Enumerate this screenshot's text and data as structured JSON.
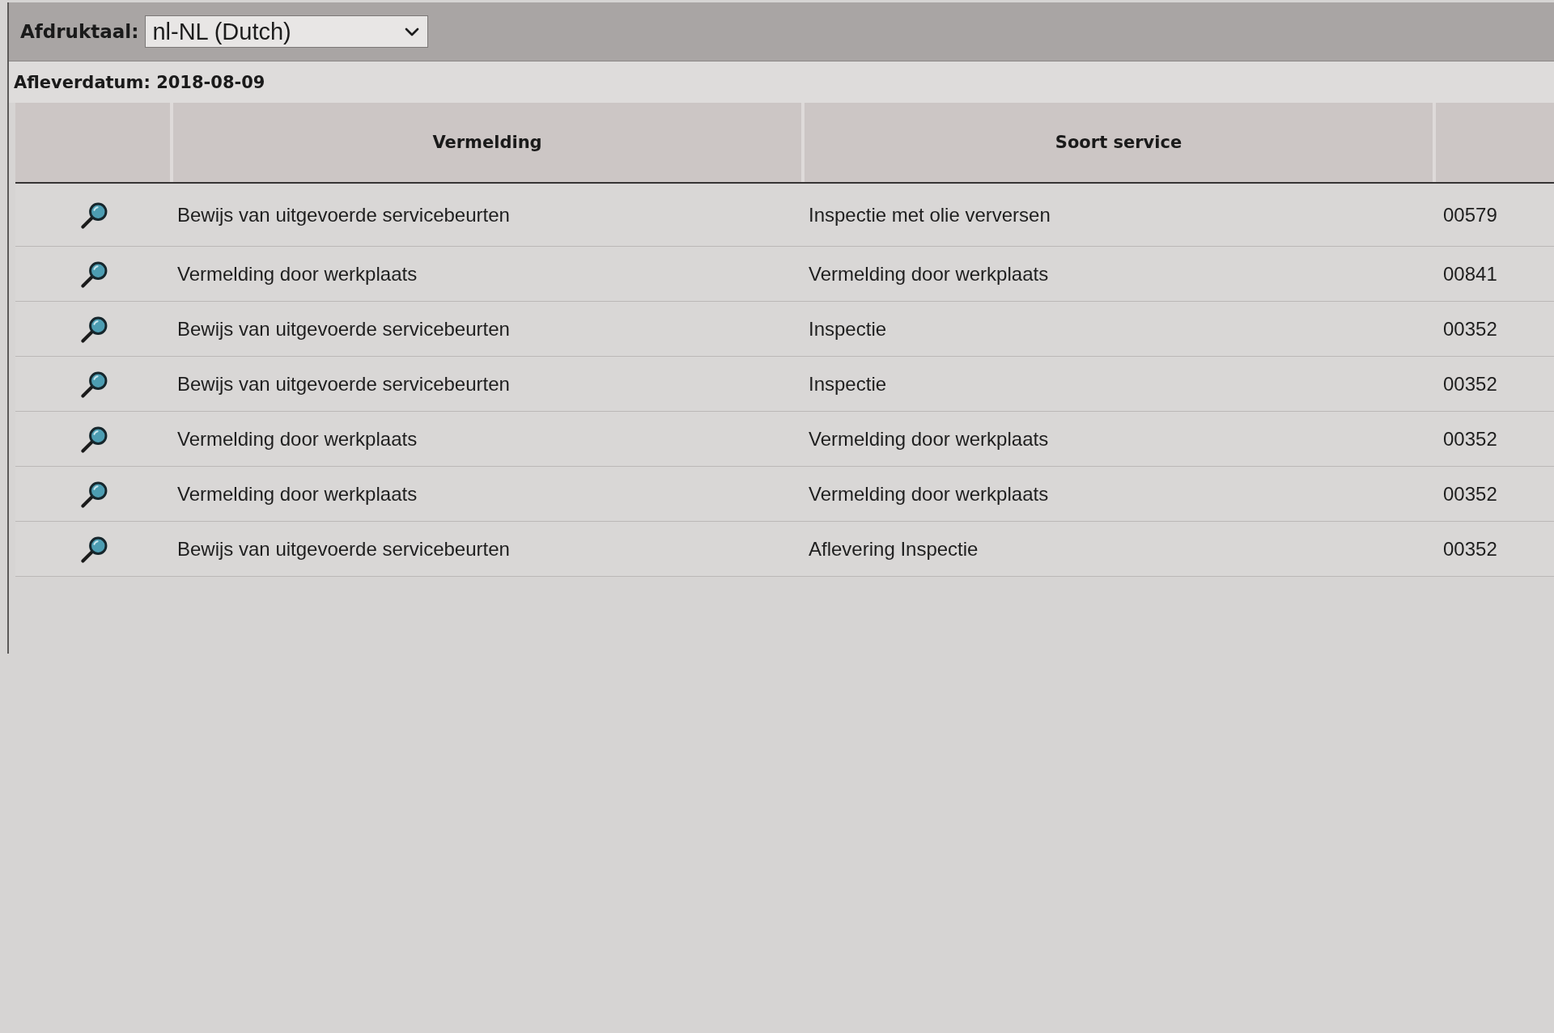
{
  "toolbar": {
    "label": "Afdruktaal:",
    "language_select": {
      "value": "nl-NL (Dutch)"
    }
  },
  "delivery_date": "Afleverdatum: 2018-08-09",
  "table": {
    "columns": [
      {
        "kind": "icon"
      },
      {
        "kind": "text",
        "label": "Vermelding"
      },
      {
        "kind": "text",
        "label": "Soort service"
      },
      {
        "kind": "code"
      }
    ],
    "rows": [
      {
        "cells": [
          "Bewijs van uitgevoerde servicebeurten",
          "Inspectie met olie verversen",
          "00579"
        ]
      },
      {
        "cells": [
          "Vermelding door werkplaats",
          "Vermelding door werkplaats",
          "00841"
        ]
      },
      {
        "cells": [
          "Bewijs van uitgevoerde servicebeurten",
          "Inspectie",
          "00352"
        ]
      },
      {
        "cells": [
          "Bewijs van uitgevoerde servicebeurten",
          "Inspectie",
          "00352"
        ]
      },
      {
        "cells": [
          "Vermelding door werkplaats",
          "Vermelding door werkplaats",
          "00352"
        ]
      },
      {
        "cells": [
          "Vermelding door werkplaats",
          "Vermelding door werkplaats",
          "00352"
        ]
      },
      {
        "cells": [
          "Bewijs van uitgevoerde servicebeurten",
          "Aflevering Inspectie",
          "00352"
        ]
      }
    ]
  }
}
